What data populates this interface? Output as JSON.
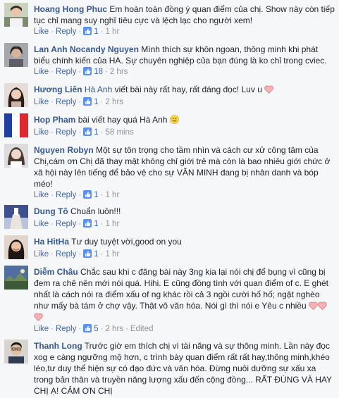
{
  "actions": {
    "like": "Like",
    "reply": "Reply",
    "separator": "·"
  },
  "colors": {
    "name": "#365899",
    "link": "#4267b2",
    "meta": "#90949c",
    "like_icon": "#5890ff",
    "heart": "#f7b2b5"
  },
  "comments": [
    {
      "author": "Hoang Hong Phuc",
      "text": "Em hoàn toàn đồng ý quan điểm của chị. Show này còn tiếp tục chỉ mang suy nghĩ tiêu cực và lệch lạc cho người xem!",
      "likes": "1",
      "time": "1 hr",
      "avatar_icon": "photo-avatar-icon"
    },
    {
      "author": "Lan Anh Nocandy Nguyen",
      "text": "Mình thích sự khôn ngoan, thông minh khi phát biểu chính kiến của HA. Sự chuyên nghiệp của bạn đúng là ko chỉ trong cviec.",
      "likes": "18",
      "time": "2 hrs",
      "avatar_icon": "photo-avatar-icon"
    },
    {
      "author": "Hương Liên",
      "tagged": "Hà Anh",
      "text": "viết bài này rất hay, rất đáng đọc! Luv u",
      "likes": "1",
      "time": "2 hrs",
      "avatar_icon": "photo-avatar-icon",
      "emoji": "heart-icon"
    },
    {
      "author": "Hop Pham",
      "text": "bài viết hay quá Hà Anh",
      "likes": "1",
      "time": "58 mins",
      "avatar_icon": "french-flag-avatar-icon",
      "emoji": "smiley-icon"
    },
    {
      "author": "Nguyen Robyn",
      "text": "Một sự tôn trọng cho tầm nhìn và cách cư xử công tâm của Chị,cám ơn Chị đã thay mặt không chỉ giới trẻ mà còn là bao nhiêu giới chức ở xã hội này lên tiếng để bảo vệ cho sự VĂN MINH đang bị nhân danh và bóp méo!",
      "likes": "1",
      "time": "1 hr",
      "avatar_icon": "photo-avatar-icon"
    },
    {
      "author": "Dung Tô",
      "text": "Chuẩn luôn!!!",
      "likes": "1",
      "time": "1 hr",
      "avatar_icon": "photo-avatar-icon"
    },
    {
      "author": "Ha HitHa",
      "text": "Tư duy tuyệt vời,good on you",
      "likes": "1",
      "time": "1 hr",
      "avatar_icon": "photo-avatar-icon"
    },
    {
      "author": "Diễm Châu",
      "text": "Chắc sau khi c đăng bài này 3ng kia lại nói chị để bụng vì cũng bị đem ra chê nên mới nói quá. Hihi. E cũng đồng tình với quan điểm of c. E ghét nhất là cách nói ra điểm xấu of ng khác rồi cả 3 ngồi cười hố hố; ngặt nghèo như mấy bà tám ở chợ vậy. Thật vô văn hóa. Nói gì thì nói e Yêu c nhiều",
      "likes": "5",
      "time": "2 hrs",
      "edited": "Edited",
      "avatar_icon": "photo-avatar-icon",
      "emoji": "three-hearts-icon"
    },
    {
      "author": "Thanh Long",
      "text": "Trước giờ em thích chị vì tài năng và sự thông minh. Lần này đọc xog e càng ngưỡng mộ hơn, c trình bày quan điểm rất rất hay,thông minh,khéo léo,tư duy thể hiện sự có đạo đức và văn hóa. Đừng nuôi dưỡng sự xấu xa trong bản thân và truyền năng lượng xấu đến cộng đồng... RẤT ĐÚNG VÀ HAY CHỊ Ạ! CẢM ƠN CHỊ",
      "avatar_icon": "photo-avatar-icon"
    }
  ]
}
